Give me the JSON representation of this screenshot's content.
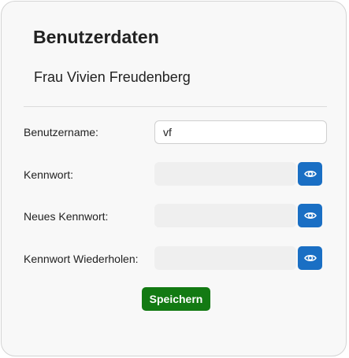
{
  "form": {
    "title": "Benutzerdaten",
    "user_display_name": "Frau Vivien Freudenberg",
    "fields": {
      "username": {
        "label": "Benutzername:",
        "value": "vf"
      },
      "password": {
        "label": "Kennwort:",
        "value": ""
      },
      "new_password": {
        "label": "Neues Kennwort:",
        "value": ""
      },
      "repeat_password": {
        "label": "Kennwort Wiederholen:",
        "value": ""
      }
    },
    "toggle_icon": "eye-icon",
    "save_label": "Speichern"
  },
  "colors": {
    "card_background": "#f8f8f8",
    "toggle_button": "#1a6fc4",
    "save_button": "#137a13",
    "password_field_background": "#efefef"
  }
}
